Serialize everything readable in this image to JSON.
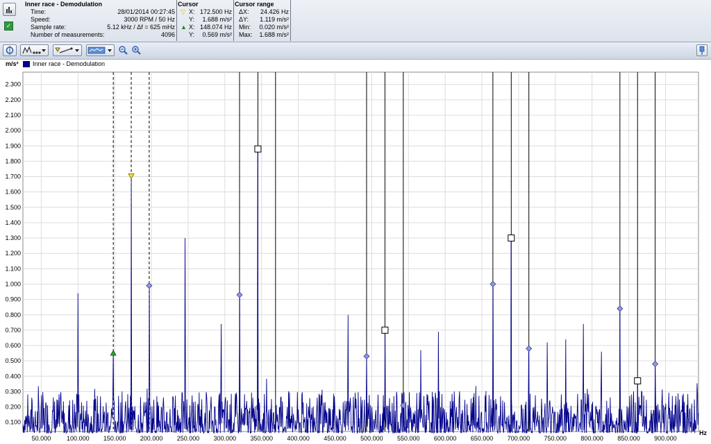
{
  "info": {
    "title": "Inner race - Demodulation",
    "rows": [
      {
        "label": "Time:",
        "value": "28/01/2014 00:27:45"
      },
      {
        "label": "Speed:",
        "value": "3000 RPM / 50 Hz"
      },
      {
        "label": "Sample rate:",
        "value": "5.12 kHz / Δf = 625 mHz"
      },
      {
        "label": "Number of measurements:",
        "value": "4096"
      }
    ]
  },
  "cursor": {
    "title": "Cursor",
    "rows": [
      {
        "marker": "▽",
        "marker_color": "#d4c000",
        "label": "X:",
        "value": "172.500 Hz"
      },
      {
        "marker": "",
        "marker_color": "",
        "label": "Y:",
        "value": "1.688 m/s²"
      },
      {
        "marker": "▲",
        "marker_color": "#1a8a22",
        "label": "X:",
        "value": "148.074 Hz"
      },
      {
        "marker": "",
        "marker_color": "",
        "label": "Y:",
        "value": "0.569 m/s²"
      }
    ]
  },
  "cursor_range": {
    "title": "Cursor range",
    "rows": [
      {
        "label": "ΔX:",
        "value": "24.426 Hz"
      },
      {
        "label": "ΔY:",
        "value": "1.119 m/s²"
      },
      {
        "label": "Min:",
        "value": "0.020 m/s²"
      },
      {
        "label": "Max:",
        "value": "1.688 m/s²"
      }
    ]
  },
  "legend": {
    "unit": "m/s²",
    "series_name": "Inner race - Demodulation",
    "series_color": "#00008b"
  },
  "chart_data": {
    "type": "line",
    "title": "",
    "xlabel": "Hz",
    "ylabel": "m/s²",
    "xlim": [
      25,
      945
    ],
    "ylim": [
      0.04,
      2.38
    ],
    "x_ticks": [
      50,
      100,
      150,
      200,
      250,
      300,
      350,
      400,
      450,
      500,
      550,
      600,
      650,
      700,
      750,
      800,
      850,
      900
    ],
    "x_tick_labels": [
      "50.000",
      "100.000",
      "150.000",
      "200.000",
      "250.000",
      "300.000",
      "350.000",
      "400.000",
      "450.000",
      "500.000",
      "550.000",
      "600.000",
      "650.000",
      "700.000",
      "750.000",
      "800.000",
      "850.000",
      "900.000"
    ],
    "y_ticks": [
      0.1,
      0.2,
      0.3,
      0.4,
      0.5,
      0.6,
      0.7,
      0.8,
      0.9,
      1.0,
      1.1,
      1.2,
      1.3,
      1.4,
      1.5,
      1.6,
      1.7,
      1.8,
      1.9,
      2.0,
      2.1,
      2.2,
      2.3
    ],
    "y_tick_labels": [
      "0.100",
      "0.200",
      "0.300",
      "0.400",
      "0.500",
      "0.600",
      "0.700",
      "0.800",
      "0.900",
      "1.000",
      "1.100",
      "1.200",
      "1.300",
      "1.400",
      "1.500",
      "1.600",
      "1.700",
      "1.800",
      "1.900",
      "2.000",
      "2.100",
      "2.200",
      "2.300"
    ],
    "grid": true,
    "series": [
      {
        "name": "Inner race - Demodulation",
        "color": "#00008b"
      }
    ],
    "noise_floor": [
      0.03,
      0.2
    ],
    "peaks": [
      {
        "x": 100,
        "y": 0.94
      },
      {
        "x": 148,
        "y": 0.57
      },
      {
        "x": 172.5,
        "y": 1.69
      },
      {
        "x": 197,
        "y": 0.99
      },
      {
        "x": 246,
        "y": 1.3
      },
      {
        "x": 295,
        "y": 0.74
      },
      {
        "x": 320,
        "y": 0.93
      },
      {
        "x": 345,
        "y": 1.88
      },
      {
        "x": 369,
        "y": 0.12
      },
      {
        "x": 468,
        "y": 0.8
      },
      {
        "x": 493,
        "y": 0.53
      },
      {
        "x": 518,
        "y": 0.7
      },
      {
        "x": 543,
        "y": 0.21
      },
      {
        "x": 567,
        "y": 0.57
      },
      {
        "x": 591,
        "y": 0.69
      },
      {
        "x": 665,
        "y": 1.0
      },
      {
        "x": 690,
        "y": 1.3
      },
      {
        "x": 714,
        "y": 0.58
      },
      {
        "x": 739,
        "y": 0.62
      },
      {
        "x": 764,
        "y": 0.64
      },
      {
        "x": 788,
        "y": 0.74
      },
      {
        "x": 813,
        "y": 0.56
      },
      {
        "x": 838,
        "y": 0.84
      },
      {
        "x": 862,
        "y": 0.37
      },
      {
        "x": 886,
        "y": 0.48
      }
    ],
    "cursor_dashed_x": [
      148.074,
      172.5,
      197
    ],
    "harmonic_lines_x": [
      320,
      345,
      369,
      493,
      518,
      543,
      665,
      690,
      714,
      838,
      862,
      886
    ],
    "markers": [
      {
        "shape": "triangle-down",
        "x": 172.5,
        "y": 1.7,
        "color": "#f2e23a"
      },
      {
        "shape": "triangle-up",
        "x": 148.074,
        "y": 0.55,
        "color": "#2ca02c"
      },
      {
        "shape": "diamond",
        "x": 197,
        "y": 0.99
      },
      {
        "shape": "diamond",
        "x": 320,
        "y": 0.93
      },
      {
        "shape": "diamond",
        "x": 493,
        "y": 0.53
      },
      {
        "shape": "diamond",
        "x": 543,
        "y": 0.21
      },
      {
        "shape": "diamond",
        "x": 665,
        "y": 1.0
      },
      {
        "shape": "diamond",
        "x": 714,
        "y": 0.58
      },
      {
        "shape": "diamond",
        "x": 838,
        "y": 0.84
      },
      {
        "shape": "diamond",
        "x": 886,
        "y": 0.48
      },
      {
        "shape": "square",
        "x": 345,
        "y": 1.88
      },
      {
        "shape": "square",
        "x": 518,
        "y": 0.7
      },
      {
        "shape": "square",
        "x": 690,
        "y": 1.3
      },
      {
        "shape": "square",
        "x": 862,
        "y": 0.37
      }
    ]
  },
  "icons": {
    "app": "app-icon",
    "checkbox": "checkbox-icon",
    "cursor_tool": "cursor-tool-icon",
    "chart_type": "chart-type-icon",
    "line_style": "line-style-icon",
    "display_mode": "display-mode-icon",
    "zoom_out": "zoom-out-icon",
    "zoom_in": "zoom-in-icon",
    "pin": "pin-icon"
  }
}
